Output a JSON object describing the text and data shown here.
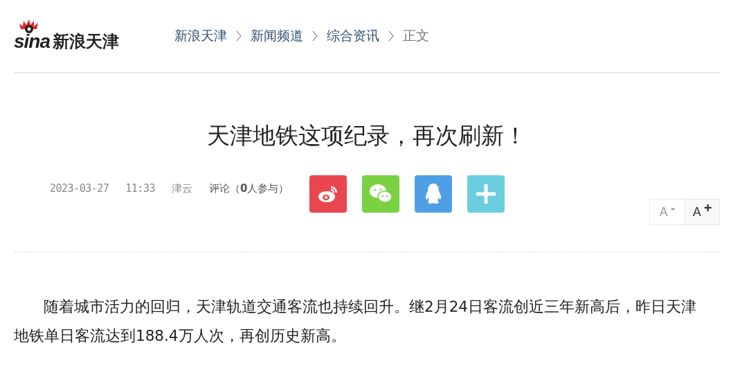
{
  "logo": {
    "brand": "sina",
    "site": "新浪天津"
  },
  "breadcrumb": [
    {
      "label": "新浪天津",
      "current": false
    },
    {
      "label": "新闻频道",
      "current": false
    },
    {
      "label": "综合资讯",
      "current": false
    },
    {
      "label": "正文",
      "current": true
    }
  ],
  "article": {
    "title": "天津地铁这项纪录，再次刷新！",
    "date": "2023-03-27",
    "time": "11:33",
    "source": "津云",
    "comments": "评论（**0**人参与）",
    "share": [
      {
        "kind": "weibo",
        "color": "#e9464e"
      },
      {
        "kind": "wechat",
        "color": "#7ad243"
      },
      {
        "kind": "qq",
        "color": "#4f9fe6"
      },
      {
        "kind": "more",
        "color": "#6acde0"
      }
    ],
    "font_size": [
      {
        "label": "A",
        "sign": "-",
        "disabled": true
      },
      {
        "label": "A",
        "sign": "+",
        "disabled": false
      }
    ],
    "paragraphs": [
      "随着城市活力的回归，天津轨道交通客流也持续回升。继2月24日客流创近三年新高后，昨日天津地铁单日客流达到188.4万人次，再创历史新高。"
    ]
  }
}
